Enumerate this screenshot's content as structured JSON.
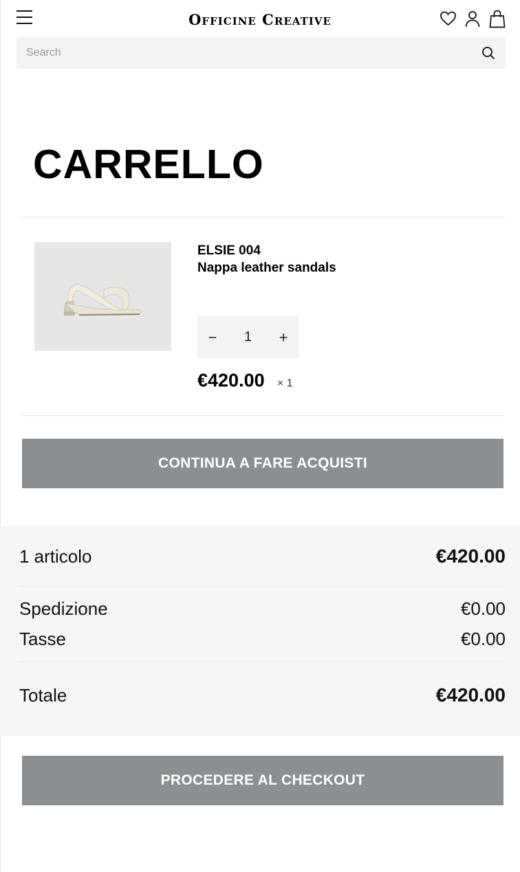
{
  "header": {
    "logo": "Officine Creative",
    "icons": [
      "menu-icon",
      "heart-icon",
      "user-icon",
      "bag-icon"
    ]
  },
  "search": {
    "placeholder": "Search",
    "icon": "search-icon"
  },
  "page": {
    "title": "CARRELLO"
  },
  "cart_item": {
    "name": "ELSIE 004",
    "description": "Nappa leather sandals",
    "quantity": "1",
    "minus_label": "−",
    "plus_label": "+",
    "price": "€420.00",
    "multiplier": "× 1"
  },
  "actions": {
    "continue_label": "CONTINUA A FARE ACQUISTI",
    "checkout_label": "PROCEDERE AL CHECKOUT"
  },
  "summary": {
    "items_label": "1 articolo",
    "items_value": "€420.00",
    "shipping_label": "Spedizione",
    "shipping_value": "€0.00",
    "tax_label": "Tasse",
    "tax_value": "€0.00",
    "total_label": "Totale",
    "total_value": "€420.00"
  },
  "colors": {
    "button_grey": "#8c8f92",
    "panel_grey": "#f6f6f6",
    "image_bg": "#e6e6e6"
  }
}
